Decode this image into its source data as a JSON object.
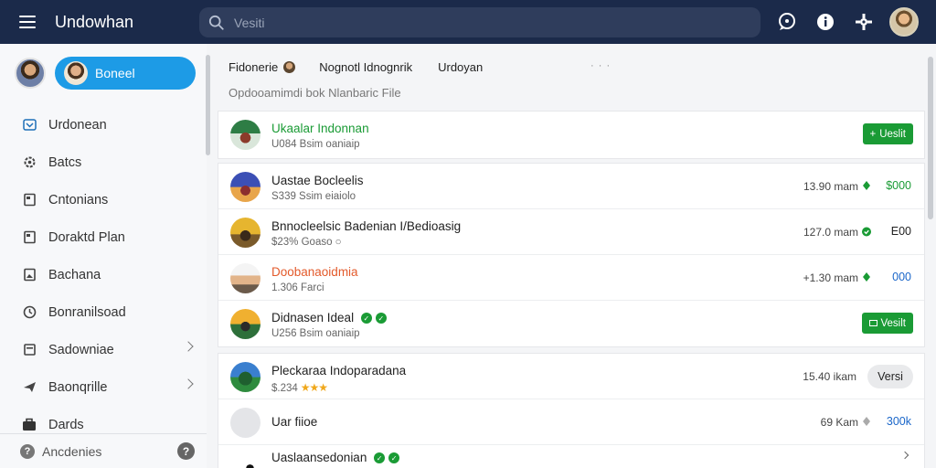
{
  "app": {
    "title": "Undowhan"
  },
  "search": {
    "placeholder": "Vesiti"
  },
  "sidebar": {
    "pill_label": "Boneel",
    "items": [
      {
        "label": "Urdonean",
        "icon": "image-icon"
      },
      {
        "label": "Batcs",
        "icon": "gear-icon"
      },
      {
        "label": "Cntonians",
        "icon": "document-icon"
      },
      {
        "label": "Doraktd Plan",
        "icon": "document-icon"
      },
      {
        "label": "Bachana",
        "icon": "image-icon"
      },
      {
        "label": "Bonranilsoad",
        "icon": "clock-icon"
      },
      {
        "label": "Sadowniae",
        "icon": "document-icon"
      },
      {
        "label": "Baonqrille",
        "icon": "send-icon"
      },
      {
        "label": "Dards",
        "icon": "briefcase-icon"
      }
    ],
    "footer_label": "Ancdenies",
    "help_label": "?"
  },
  "main": {
    "tabs": [
      "Fidonerie",
      "Nognotl Idnognrik",
      "Urdoyan"
    ],
    "tabs_dots": "· · ·",
    "subtitle": "Opdooamimdi bok Nlanbaric File",
    "featured": {
      "title": "Ukaalar Indonnan",
      "sub": "U084 Bsim oaniaip",
      "button": "Ueslit",
      "title_color": "#1a9b35"
    },
    "rows": [
      {
        "title": "Uastae Bocleelis",
        "sub": "S339 Ssim eiaiolo",
        "size": "13.90 mam",
        "amount": "$000",
        "amount_color": "#1a9b35",
        "title_color": "#222222"
      },
      {
        "title": "Bnnocleelsic Badenian I/Bedioasig",
        "sub": "$23% Goaso ○",
        "size": "127.0 mam",
        "amount": "E00",
        "amount_color": "#222222",
        "title_color": "#222222"
      },
      {
        "title": "Doobanaoidmia",
        "sub": "1.306 Farci",
        "size": "+1.30 mam",
        "amount": "000",
        "amount_color": "#1a66c9",
        "title_color": "#e35a2b"
      },
      {
        "title": "Didnasen Ideal",
        "sub": "U256 Bsim oaniaip",
        "button": "Vesilt",
        "title_color": "#222222"
      }
    ],
    "rows2": [
      {
        "title": "Pleckaraa Indoparadana",
        "sub": "$.234",
        "stars": "★★★",
        "size": "15.40 ikam",
        "button": "Versi"
      },
      {
        "title": "Uar fiioe",
        "size": "69 Kam",
        "amount": "300k",
        "amount_color": "#1a66c9"
      },
      {
        "title": "Uaslaansedonian"
      }
    ]
  }
}
